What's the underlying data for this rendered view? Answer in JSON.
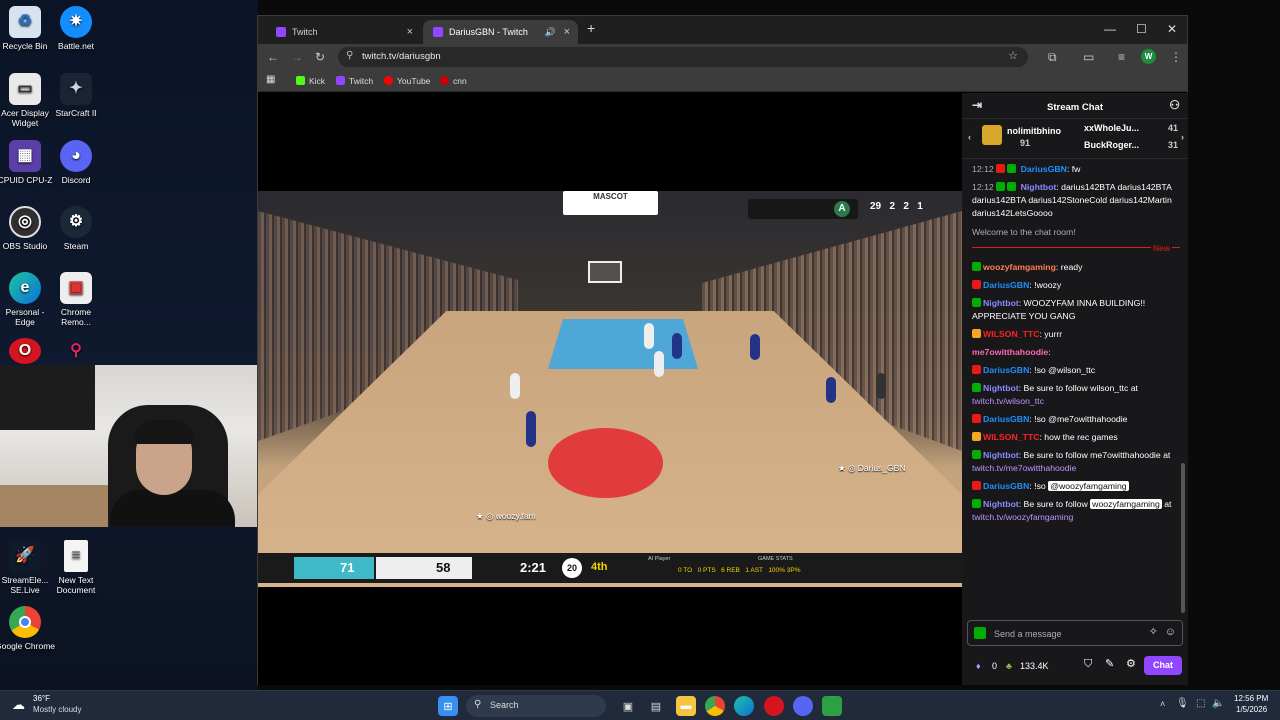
{
  "desktop": {
    "icons": [
      {
        "label": "Recycle Bin",
        "icon": "recycle-bin-icon"
      },
      {
        "label": "Battle.net",
        "icon": "battlenet-icon"
      },
      {
        "label": "Acer Display Widget",
        "icon": "acer-icon"
      },
      {
        "label": "StarCraft II",
        "icon": "starcraft-icon"
      },
      {
        "label": "CPUID CPU-Z",
        "icon": "cpuz-icon"
      },
      {
        "label": "Discord",
        "icon": "discord-icon"
      },
      {
        "label": "OBS Studio",
        "icon": "obs-icon"
      },
      {
        "label": "Steam",
        "icon": "steam-icon"
      },
      {
        "label": "Personal - Edge",
        "icon": "edge-icon"
      },
      {
        "label": "Chrome Remo...",
        "icon": "chrome-remote-icon"
      },
      {
        "label": "StreamEle... SE.Live",
        "icon": "streamelements-icon"
      },
      {
        "label": "New Text Document",
        "icon": "text-document-icon"
      },
      {
        "label": "Google Chrome",
        "icon": "chrome-icon"
      }
    ]
  },
  "browser": {
    "tabs": [
      {
        "title": "Twitch",
        "active": false
      },
      {
        "title": "DariusGBN - Twitch",
        "active": true
      }
    ],
    "url": "twitch.tv/dariusgbn",
    "bookmarks": [
      "Kick",
      "Twitch",
      "YouTube",
      "cnn"
    ],
    "profile_initial": "W"
  },
  "game": {
    "mascot": "MASCOT",
    "player_tag_1": "Darius_GBN",
    "player_tag_2": "woozy.fam",
    "top_score": {
      "pts": "29",
      "reb": "2",
      "ast": "2",
      "grade": "A",
      "misc": "1"
    },
    "hud": {
      "team1": "71",
      "team2": "58",
      "clock": "2:21",
      "shot_clock": "20",
      "quarter": "4th",
      "ai_label": "AI Player",
      "stat_label": "GAME STATS",
      "stats": "0 TO   0 PTS   6 REB   1 AST   100% 3P%"
    }
  },
  "chat": {
    "title": "Stream Chat",
    "gifts": {
      "top_user": "nolimitbhino",
      "top_count": "91",
      "user2": "xxWholeJu...",
      "count2": "41",
      "user3": "BuckRoger...",
      "count3": "31"
    },
    "messages": [
      {
        "time": "12:12",
        "user": "DariusGBN",
        "color": "#1e90ff",
        "text": ": fw"
      },
      {
        "time": "12:12",
        "user": "Nightbot",
        "color": "#8a8aff",
        "text": ": darius142BTA darius142BTA darius142BTA darius142StoneCold darius142Martin darius142LetsGoooo"
      }
    ],
    "system": "Welcome to the chat room!",
    "new_label": "New",
    "messages2": [
      {
        "user": "woozyfamgaming",
        "color": "#ff7f50",
        "text": ": ready"
      },
      {
        "user": "DariusGBN",
        "color": "#1e90ff",
        "text": ": !woozy"
      },
      {
        "user": "Nightbot",
        "color": "#8a8aff",
        "text": ": WOOZYFAM INNA BUILDING!! APPRECIATE YOU GANG"
      },
      {
        "user": "WILSON_TTC",
        "color": "#ff2020",
        "text": ": yurrr"
      },
      {
        "user": "me7owitthahoodie",
        "color": "#ff69b4",
        "text": ":"
      },
      {
        "user": "DariusGBN",
        "color": "#1e90ff",
        "text": ": !so @wilson_ttc"
      },
      {
        "user": "Nightbot",
        "color": "#8a8aff",
        "text": ": Be sure to follow wilson_ttc at ",
        "link": "twitch.tv/wilson_ttc"
      },
      {
        "user": "DariusGBN",
        "color": "#1e90ff",
        "text": ": !so @me7owitthahoodie"
      },
      {
        "user": "WILSON_TTC",
        "color": "#ff2020",
        "text": ": how the rec games"
      },
      {
        "user": "Nightbot",
        "color": "#8a8aff",
        "text": ": Be sure to follow me7owitthahoodie at ",
        "link": "twitch.tv/me7owitthahoodie"
      },
      {
        "user": "DariusGBN",
        "color": "#1e90ff",
        "text": ": !so ",
        "mention": "@woozyfamgaming"
      },
      {
        "user": "Nightbot",
        "color": "#8a8aff",
        "text": ": Be sure to follow ",
        "mention": "woozyfamgaming",
        "text2": " at ",
        "link": "twitch.tv/woozyfamgaming"
      }
    ],
    "input_placeholder": "Send a message",
    "points": "0",
    "channel_points": "133.4K",
    "chat_button": "Chat"
  },
  "taskbar": {
    "weather_temp": "36°F",
    "weather_desc": "Mostly cloudy",
    "search_placeholder": "Search",
    "time": "12:56 PM",
    "date": "1/5/2026"
  }
}
